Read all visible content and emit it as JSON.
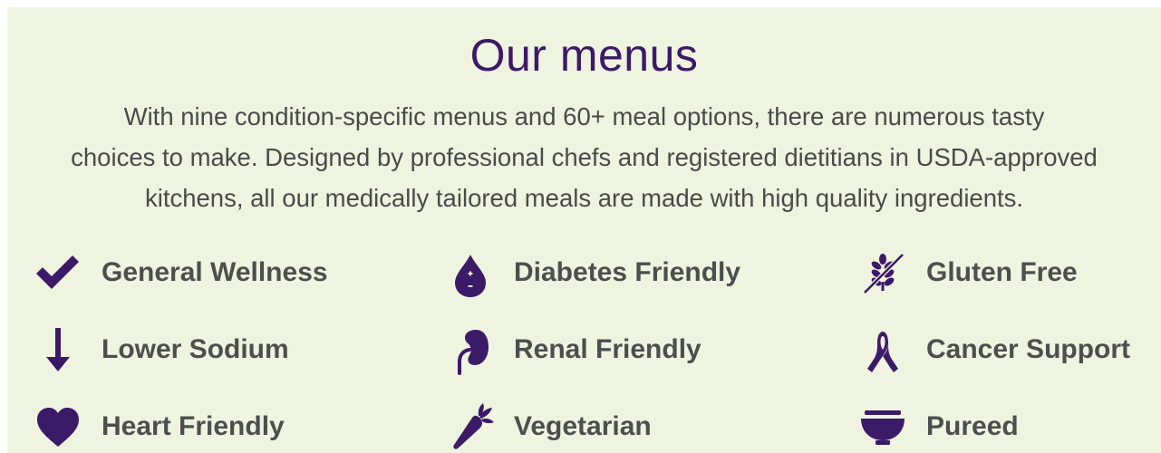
{
  "section": {
    "title": "Our menus",
    "intro_lines": [
      "With nine condition-specific menus and 60+ meal options, there are numerous tasty",
      "choices to make. Designed by professional chefs and registered dietitians in USDA-approved",
      "kitchens, all our medically tailored meals are made with high quality ingredients."
    ]
  },
  "menus": [
    {
      "label": "General Wellness",
      "icon": "checkmark-icon"
    },
    {
      "label": "Diabetes Friendly",
      "icon": "blood-drop-icon"
    },
    {
      "label": "Gluten Free",
      "icon": "wheat-crossed-icon"
    },
    {
      "label": "Lower Sodium",
      "icon": "down-arrow-icon"
    },
    {
      "label": "Renal Friendly",
      "icon": "kidney-icon"
    },
    {
      "label": "Cancer Support",
      "icon": "ribbon-icon"
    },
    {
      "label": "Heart Friendly",
      "icon": "heart-icon"
    },
    {
      "label": "Vegetarian",
      "icon": "carrot-icon"
    },
    {
      "label": "Pureed",
      "icon": "bowl-icon"
    }
  ],
  "colors": {
    "background": "#eff4e1",
    "accent": "#3b1a67",
    "text": "#4e4e4e"
  }
}
